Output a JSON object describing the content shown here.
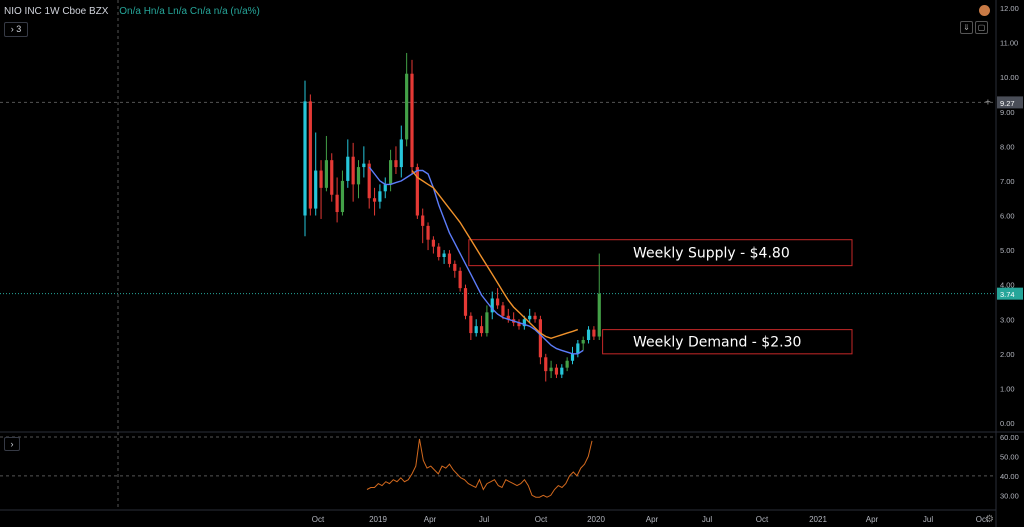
{
  "header": {
    "symbol": "NIO INC  1W  Cboe BZX",
    "ohlc": "On/a  Hn/a  Ln/a  Cn/a  n/a (n/a%)"
  },
  "indicator_toggle": "› 3",
  "subpane_toggle": "›",
  "toolbar": {
    "download_icon": "⇓",
    "fullscreen_icon": "▢"
  },
  "annotations": [
    {
      "label": "Weekly Supply - $4.80",
      "price_top": 5.3,
      "price_bottom": 4.55
    },
    {
      "label": "Weekly Demand - $2.30",
      "price_top": 2.7,
      "price_bottom": 2.0
    }
  ],
  "colors": {
    "up": "#26c6da",
    "down": "#e53935",
    "alt_up": "#43a047",
    "ma_fast": "#5c7cfa",
    "ma_slow": "#f0922b",
    "rsi": "#d2691e",
    "zone": "#c62828",
    "text": "#ffffff"
  },
  "chart_data": {
    "type": "candlestick",
    "x_axis_labels": [
      "Oct",
      "2019",
      "Apr",
      "Jul",
      "Oct",
      "2020",
      "Apr",
      "Jul",
      "Oct",
      "2021",
      "Apr",
      "Jul",
      "Oct"
    ],
    "y_axis_ticks": [
      "12.00",
      "11.00",
      "10.00",
      "9.00",
      "8.00",
      "7.00",
      "6.00",
      "5.00",
      "4.00",
      "3.00",
      "2.00",
      "1.00",
      "0.00"
    ],
    "ylim": [
      0,
      12
    ],
    "crosshair_price": "9.27",
    "last_price": "3.74",
    "candles": [
      [
        6.0,
        9.9,
        5.4,
        9.3
      ],
      [
        9.3,
        9.5,
        6.0,
        6.2
      ],
      [
        6.2,
        8.4,
        6.0,
        7.3
      ],
      [
        7.3,
        7.6,
        5.9,
        6.8
      ],
      [
        6.8,
        8.3,
        6.7,
        7.6
      ],
      [
        7.6,
        7.8,
        6.4,
        6.6
      ],
      [
        6.6,
        7.1,
        5.8,
        6.1
      ],
      [
        6.1,
        7.3,
        6.0,
        7.0
      ],
      [
        7.0,
        8.2,
        6.8,
        7.7
      ],
      [
        7.7,
        8.1,
        6.4,
        6.9
      ],
      [
        6.9,
        7.6,
        6.5,
        7.4
      ],
      [
        7.4,
        8.0,
        7.1,
        7.5
      ],
      [
        7.5,
        7.6,
        6.2,
        6.5
      ],
      [
        6.5,
        6.8,
        6.0,
        6.4
      ],
      [
        6.4,
        6.9,
        6.2,
        6.7
      ],
      [
        6.7,
        7.1,
        6.5,
        6.9
      ],
      [
        6.9,
        7.9,
        6.7,
        7.6
      ],
      [
        7.6,
        8.0,
        7.2,
        7.4
      ],
      [
        7.4,
        8.6,
        7.1,
        8.2
      ],
      [
        8.2,
        10.7,
        8.0,
        10.1
      ],
      [
        10.1,
        10.5,
        7.2,
        7.4
      ],
      [
        7.4,
        7.5,
        5.9,
        6.0
      ],
      [
        6.0,
        6.2,
        5.2,
        5.7
      ],
      [
        5.7,
        5.8,
        5.0,
        5.3
      ],
      [
        5.3,
        5.4,
        4.9,
        5.1
      ],
      [
        5.1,
        5.2,
        4.7,
        4.8
      ],
      [
        4.8,
        5.0,
        4.6,
        4.9
      ],
      [
        4.9,
        5.0,
        4.5,
        4.6
      ],
      [
        4.6,
        4.7,
        4.2,
        4.4
      ],
      [
        4.4,
        4.5,
        3.8,
        3.9
      ],
      [
        3.9,
        4.0,
        3.0,
        3.1
      ],
      [
        3.1,
        3.2,
        2.4,
        2.6
      ],
      [
        2.6,
        3.0,
        2.5,
        2.8
      ],
      [
        2.8,
        3.1,
        2.5,
        2.6
      ],
      [
        2.6,
        3.4,
        2.5,
        3.2
      ],
      [
        3.2,
        3.8,
        3.0,
        3.6
      ],
      [
        3.6,
        3.9,
        3.3,
        3.4
      ],
      [
        3.4,
        3.5,
        3.0,
        3.1
      ],
      [
        3.1,
        3.3,
        2.9,
        3.0
      ],
      [
        3.0,
        3.2,
        2.8,
        2.9
      ],
      [
        2.9,
        3.0,
        2.7,
        2.8
      ],
      [
        2.8,
        3.1,
        2.7,
        3.0
      ],
      [
        3.0,
        3.3,
        2.9,
        3.1
      ],
      [
        3.1,
        3.2,
        2.9,
        3.0
      ],
      [
        3.0,
        3.1,
        1.7,
        1.9
      ],
      [
        1.9,
        2.0,
        1.2,
        1.5
      ],
      [
        1.5,
        1.8,
        1.3,
        1.6
      ],
      [
        1.6,
        1.7,
        1.3,
        1.4
      ],
      [
        1.4,
        1.7,
        1.3,
        1.6
      ],
      [
        1.6,
        1.9,
        1.5,
        1.8
      ],
      [
        1.8,
        2.2,
        1.7,
        2.0
      ],
      [
        2.0,
        2.4,
        1.9,
        2.3
      ],
      [
        2.3,
        2.5,
        2.1,
        2.4
      ],
      [
        2.4,
        2.8,
        2.3,
        2.7
      ],
      [
        2.7,
        2.8,
        2.4,
        2.5
      ],
      [
        2.5,
        4.9,
        2.4,
        3.74
      ]
    ],
    "ma_fast": [
      7.4,
      7.2,
      7.0,
      6.9,
      6.9,
      6.95,
      7.0,
      7.1,
      7.2,
      7.3,
      7.3,
      7.2,
      6.8,
      6.3,
      5.9,
      5.5,
      5.2,
      4.9,
      4.6,
      4.3,
      4.0,
      3.7,
      3.5,
      3.3,
      3.15,
      3.05,
      3.0,
      2.95,
      2.9,
      2.85,
      2.8,
      2.7,
      2.55,
      2.4,
      2.25,
      2.15,
      2.1,
      2.05,
      2.0,
      2.0,
      2.1
    ],
    "ma_slow": [
      7.3,
      7.1,
      7.0,
      6.9,
      6.8,
      6.6,
      6.4,
      6.2,
      6.0,
      5.8,
      5.55,
      5.3,
      5.05,
      4.8,
      4.55,
      4.3,
      4.05,
      3.8,
      3.55,
      3.35,
      3.2,
      3.05,
      2.9,
      2.75,
      2.6,
      2.5,
      2.45,
      2.5,
      2.55,
      2.6,
      2.65,
      2.7
    ],
    "rsi": {
      "ylim": [
        25,
        60
      ],
      "ticks": [
        "60.00",
        "50.00",
        "40.00",
        "30.00"
      ],
      "values": [
        33,
        34,
        34,
        36,
        35,
        37,
        36,
        38,
        37,
        39,
        37,
        38,
        41,
        45,
        59,
        48,
        44,
        45,
        43,
        41,
        45,
        44,
        46,
        43,
        41,
        39,
        38,
        36,
        35,
        34,
        38,
        33,
        36,
        37,
        38,
        35,
        34,
        38,
        37,
        36,
        35,
        36,
        38,
        35,
        30,
        29,
        29,
        30,
        29,
        30,
        33,
        35,
        34,
        36,
        40,
        42,
        40,
        44,
        46,
        50,
        58
      ]
    }
  }
}
